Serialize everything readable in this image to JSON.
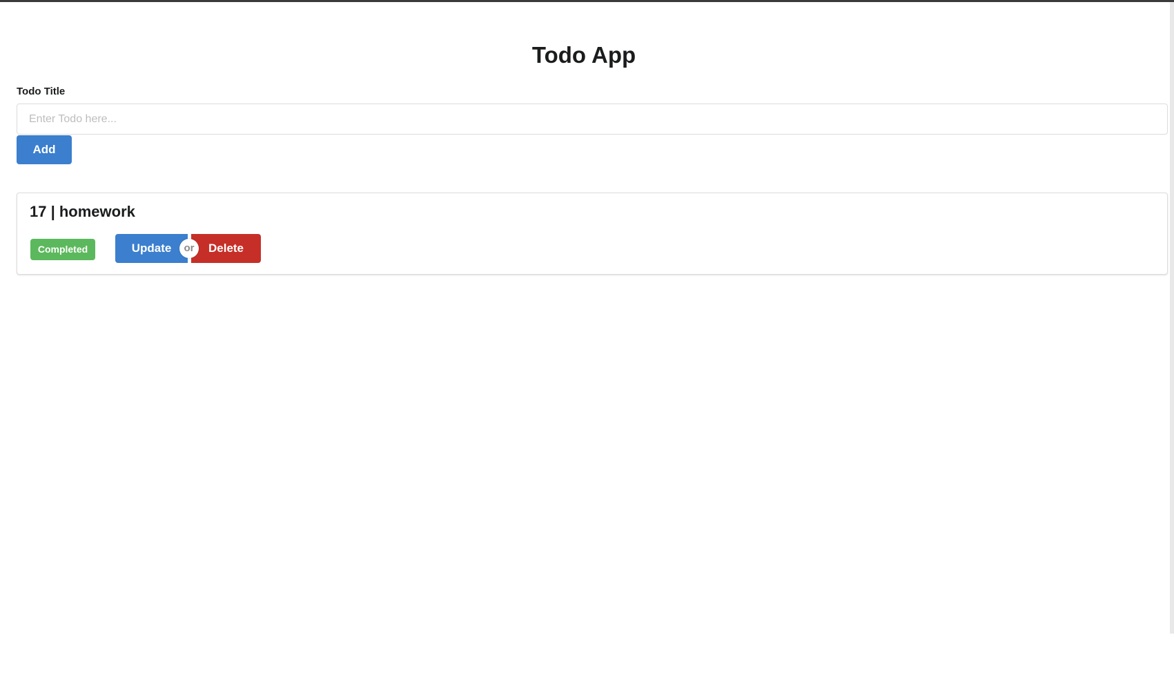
{
  "app": {
    "title": "Todo App"
  },
  "form": {
    "label": "Todo Title",
    "input_value": "",
    "placeholder": "Enter Todo here...",
    "add_label": "Add"
  },
  "todos": [
    {
      "heading": "17 | homework",
      "status": "Completed",
      "update_label": "Update",
      "or_label": "or",
      "delete_label": "Delete"
    }
  ],
  "colors": {
    "primary": "#3b7fce",
    "danger": "#c62f28",
    "success": "#5cb85c"
  }
}
